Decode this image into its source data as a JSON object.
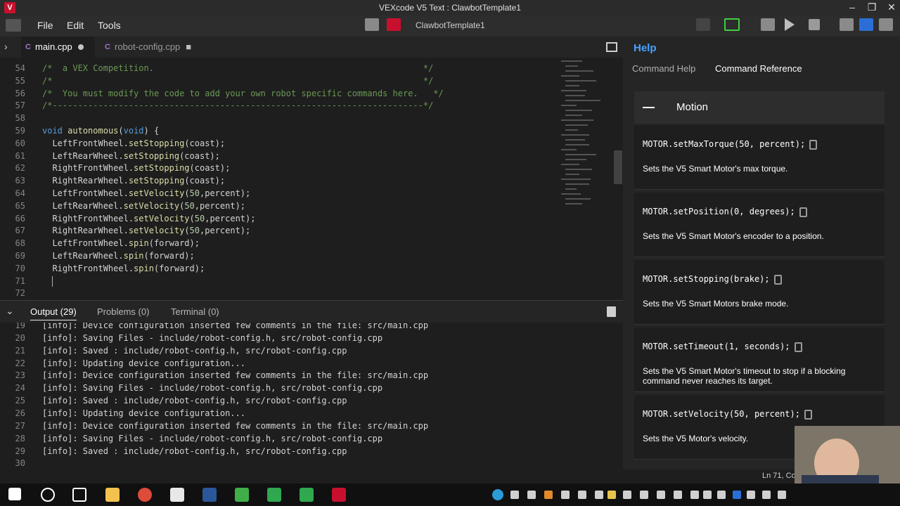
{
  "window": {
    "title": "VEXcode V5 Text : ClawbotTemplate1"
  },
  "menu": {
    "file": "File",
    "edit": "Edit",
    "tools": "Tools",
    "project_name": "ClawbotTemplate1"
  },
  "tabs": {
    "main": "main.cpp",
    "robot_config": "robot-config.cpp"
  },
  "code_lines": [
    {
      "n": "54",
      "parts": [
        [
          "comment",
          "/*  a VEX Competition.                                                     */"
        ]
      ]
    },
    {
      "n": "55",
      "parts": [
        [
          "comment",
          "/*                                                                         */"
        ]
      ]
    },
    {
      "n": "56",
      "parts": [
        [
          "comment",
          "/*  You must modify the code to add your own robot specific commands here.   */"
        ]
      ]
    },
    {
      "n": "57",
      "parts": [
        [
          "comment",
          "/*-------------------------------------------------------------------------*/"
        ]
      ]
    },
    {
      "n": "58",
      "parts": []
    },
    {
      "n": "59",
      "parts": [
        [
          "kw",
          "void"
        ],
        [
          "id",
          " "
        ],
        [
          "fn",
          "autonomous"
        ],
        [
          "id",
          "("
        ],
        [
          "kw",
          "void"
        ],
        [
          "id",
          ") {"
        ]
      ]
    },
    {
      "n": "60",
      "parts": [
        [
          "id",
          "  LeftFrontWheel."
        ],
        [
          "fn",
          "setStopping"
        ],
        [
          "id",
          "(coast);"
        ]
      ]
    },
    {
      "n": "61",
      "parts": [
        [
          "id",
          "  LeftRearWheel."
        ],
        [
          "fn",
          "setStopping"
        ],
        [
          "id",
          "(coast);"
        ]
      ]
    },
    {
      "n": "62",
      "parts": [
        [
          "id",
          "  RightFrontWheel."
        ],
        [
          "fn",
          "setStopping"
        ],
        [
          "id",
          "(coast);"
        ]
      ]
    },
    {
      "n": "63",
      "parts": [
        [
          "id",
          "  RightRearWheel."
        ],
        [
          "fn",
          "setStopping"
        ],
        [
          "id",
          "(coast);"
        ]
      ]
    },
    {
      "n": "64",
      "parts": [
        [
          "id",
          "  LeftFrontWheel."
        ],
        [
          "fn",
          "setVelocity"
        ],
        [
          "id",
          "("
        ],
        [
          "num",
          "50"
        ],
        [
          "id",
          ",percent);"
        ]
      ]
    },
    {
      "n": "65",
      "parts": [
        [
          "id",
          "  LeftRearWheel."
        ],
        [
          "fn",
          "setVelocity"
        ],
        [
          "id",
          "("
        ],
        [
          "num",
          "50"
        ],
        [
          "id",
          ",percent);"
        ]
      ]
    },
    {
      "n": "66",
      "parts": [
        [
          "id",
          "  RightFrontWheel."
        ],
        [
          "fn",
          "setVelocity"
        ],
        [
          "id",
          "("
        ],
        [
          "num",
          "50"
        ],
        [
          "id",
          ",percent);"
        ]
      ]
    },
    {
      "n": "67",
      "parts": [
        [
          "id",
          "  RightRearWheel."
        ],
        [
          "fn",
          "setVelocity"
        ],
        [
          "id",
          "("
        ],
        [
          "num",
          "50"
        ],
        [
          "id",
          ",percent);"
        ]
      ]
    },
    {
      "n": "68",
      "parts": [
        [
          "id",
          "  LeftFrontWheel."
        ],
        [
          "fn",
          "spin"
        ],
        [
          "id",
          "(forward);"
        ]
      ]
    },
    {
      "n": "69",
      "parts": [
        [
          "id",
          "  LeftRearWheel."
        ],
        [
          "fn",
          "spin"
        ],
        [
          "id",
          "(forward);"
        ]
      ]
    },
    {
      "n": "70",
      "parts": [
        [
          "id",
          "  RightFrontWheel."
        ],
        [
          "fn",
          "spin"
        ],
        [
          "id",
          "(forward);"
        ]
      ]
    },
    {
      "n": "71",
      "parts": []
    },
    {
      "n": "72",
      "parts": []
    }
  ],
  "panel": {
    "output_tab": "Output (29)",
    "problems_tab": "Problems (0)",
    "terminal_tab": "Terminal (0)"
  },
  "output_lines": [
    {
      "n": "19",
      "text": "[info]: Device configuration inserted few comments in the file: src/main.cpp"
    },
    {
      "n": "20",
      "text": "[info]: Saving Files - include/robot-config.h, src/robot-config.cpp"
    },
    {
      "n": "21",
      "text": "[info]: Saved : include/robot-config.h, src/robot-config.cpp"
    },
    {
      "n": "22",
      "text": "[info]: Updating device configuration..."
    },
    {
      "n": "23",
      "text": "[info]: Device configuration inserted few comments in the file: src/main.cpp"
    },
    {
      "n": "24",
      "text": "[info]: Saving Files - include/robot-config.h, src/robot-config.cpp"
    },
    {
      "n": "25",
      "text": "[info]: Saved : include/robot-config.h, src/robot-config.cpp"
    },
    {
      "n": "26",
      "text": "[info]: Updating device configuration..."
    },
    {
      "n": "27",
      "text": "[info]: Device configuration inserted few comments in the file: src/main.cpp"
    },
    {
      "n": "28",
      "text": "[info]: Saving Files - include/robot-config.h, src/robot-config.cpp"
    },
    {
      "n": "29",
      "text": "[info]: Saved : include/robot-config.h, src/robot-config.cpp"
    },
    {
      "n": "30",
      "text": ""
    }
  ],
  "help": {
    "title": "Help",
    "tab_command_help": "Command Help",
    "tab_command_reference": "Command Reference",
    "section": "Motion",
    "commands": [
      {
        "code": "MOTOR.setMaxTorque(50, percent);",
        "desc": "Sets the V5 Smart Motor's max torque."
      },
      {
        "code": "MOTOR.setPosition(0, degrees);",
        "desc": "Sets the V5 Smart Motor's encoder to a position."
      },
      {
        "code": "MOTOR.setStopping(brake);",
        "desc": "Sets the V5 Smart Motors brake mode."
      },
      {
        "code": "MOTOR.setTimeout(1, seconds);",
        "desc": "Sets the V5 Smart Motor's timeout to stop if a blocking command never reaches its target."
      },
      {
        "code": "MOTOR.setVelocity(50, percent);",
        "desc": "Sets the V5 Motor's velocity."
      }
    ]
  },
  "status": {
    "position": "Ln 71, Co"
  },
  "colors": {
    "accent_blue": "#4aa3ff",
    "vex_red": "#c8102e",
    "comment_green": "#6a9955",
    "keyword_blue": "#569cd6"
  }
}
